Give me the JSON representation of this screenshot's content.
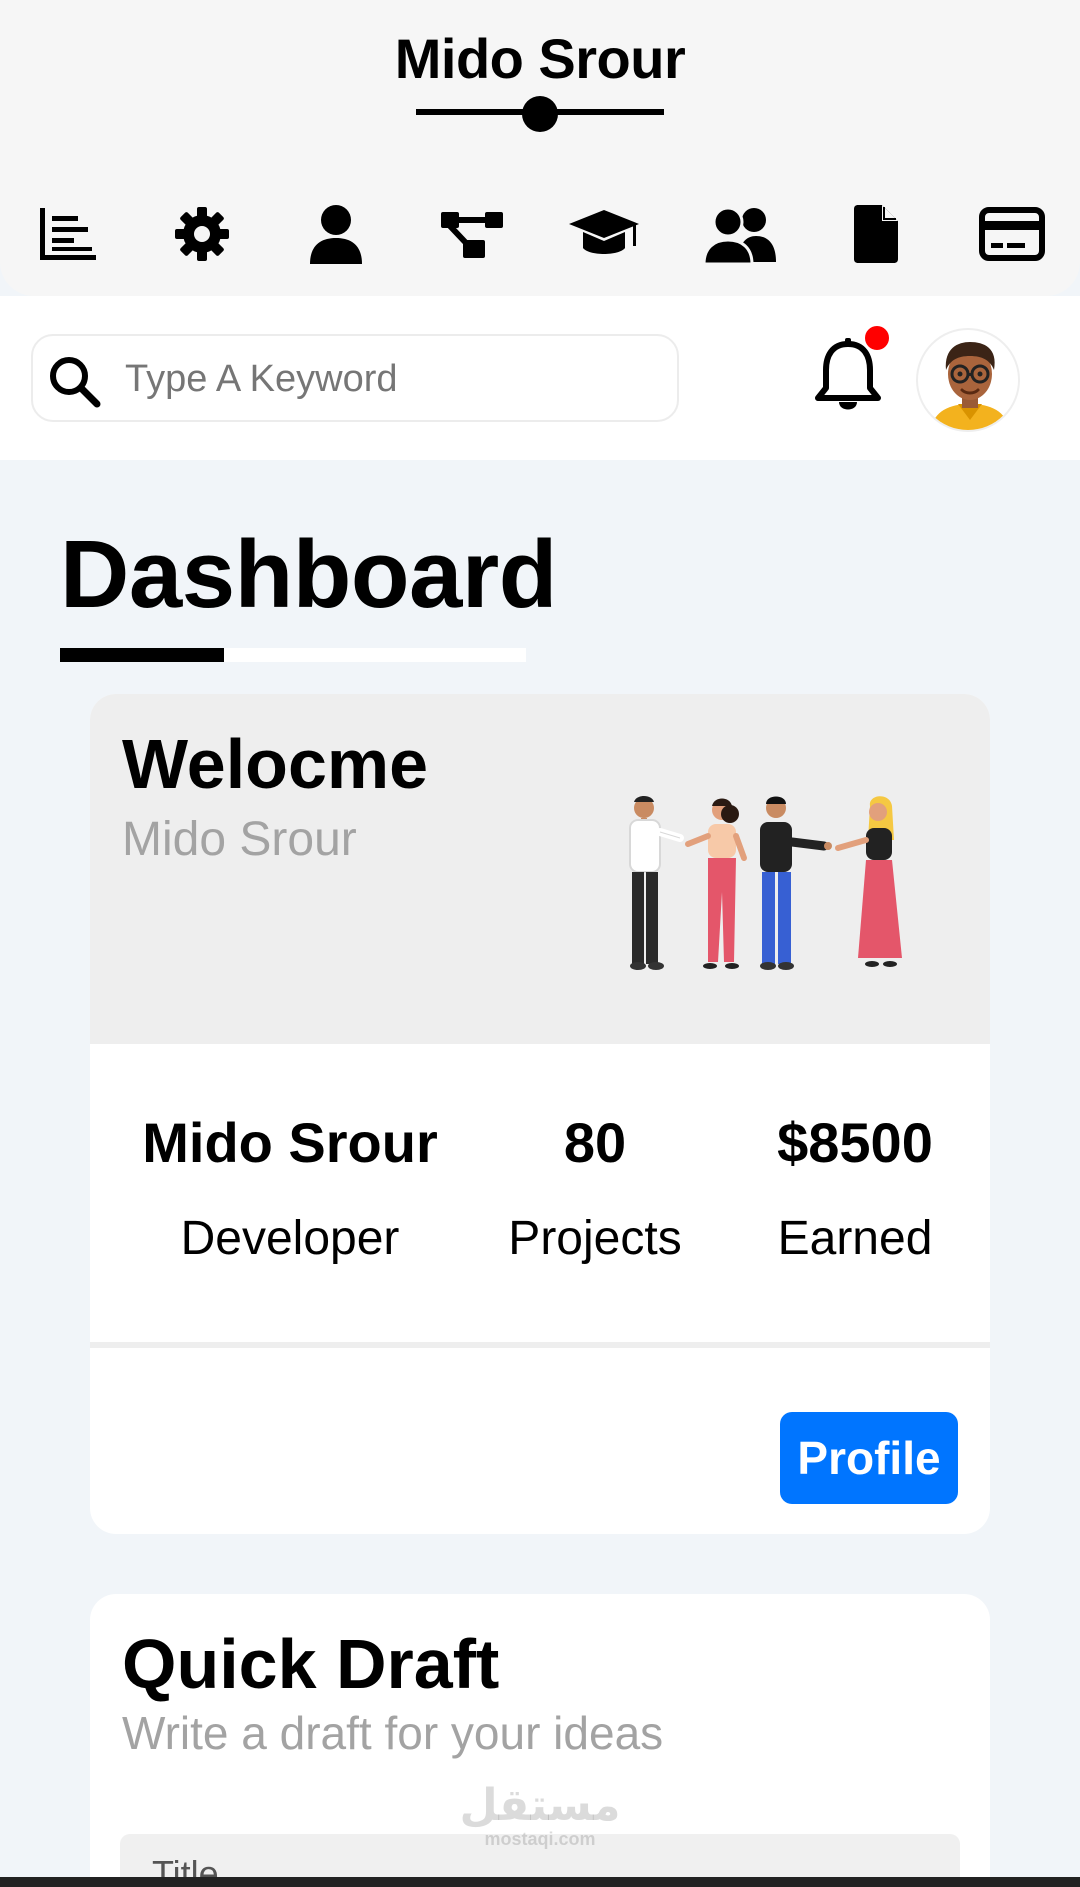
{
  "header": {
    "brand": "Mido Srour",
    "nav": [
      {
        "icon": "chart-bar-icon"
      },
      {
        "icon": "gear-icon"
      },
      {
        "icon": "user-icon"
      },
      {
        "icon": "diagram-project-icon"
      },
      {
        "icon": "graduation-cap-icon"
      },
      {
        "icon": "users-icon"
      },
      {
        "icon": "file-icon"
      },
      {
        "icon": "credit-card-icon"
      }
    ]
  },
  "search": {
    "placeholder": "Type A Keyword",
    "icon": "search-icon"
  },
  "notifications": {
    "icon": "bell-icon",
    "has_unread": true,
    "dot_color": "#ff0000"
  },
  "user": {
    "avatar": "avatar-icon"
  },
  "page": {
    "title": "Dashboard"
  },
  "welcome": {
    "title": "Welocme",
    "name": "Mido Srour",
    "illustration": "people-talking-illustration",
    "stats": [
      {
        "value": "Mido Srour",
        "label": "Developer"
      },
      {
        "value": "80",
        "label": "Projects"
      },
      {
        "value": "$8500",
        "label": "Earned"
      }
    ],
    "profile_button": "Profile"
  },
  "quick_draft": {
    "title": "Quick Draft",
    "subtitle": "Write a draft for your ideas",
    "title_placeholder": "Title"
  },
  "watermark": {
    "arabic": "مستقل",
    "latin": "mostaqi.com"
  },
  "colors": {
    "accent": "#0075ff",
    "background": "#f1f5f9",
    "card_top": "#eeeeee",
    "muted_text": "#a3a3a3"
  }
}
